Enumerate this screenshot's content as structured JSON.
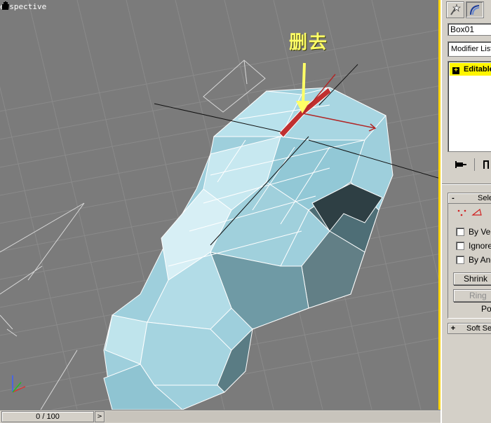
{
  "viewport": {
    "label": "erspective",
    "annotation_text": "删去",
    "colors": {
      "background": "#7b7b7b",
      "mesh": "#a9d3df",
      "selected_edge": "#c03030",
      "annotation": "#ffff66",
      "active_border": "#ffd400"
    }
  },
  "timeline": {
    "frame_readout": "0 / 100",
    "next_label": ">"
  },
  "panel": {
    "object_name": "Box01",
    "modifier_list": "Modifier List",
    "stack_item": "Editable Poly",
    "selection_rollout": {
      "toggle": "-",
      "title": "Selection",
      "checkboxes": [
        {
          "label": "By Vertex",
          "checked": false
        },
        {
          "label": "Ignore Backfacing",
          "checked": false
        },
        {
          "label": "By Angle",
          "checked": false
        }
      ],
      "shrink_label": "Shrink",
      "ring_label": "Ring",
      "po_label": "Po"
    },
    "soft_rollout": {
      "toggle": "+",
      "title": "Soft Selection"
    }
  }
}
